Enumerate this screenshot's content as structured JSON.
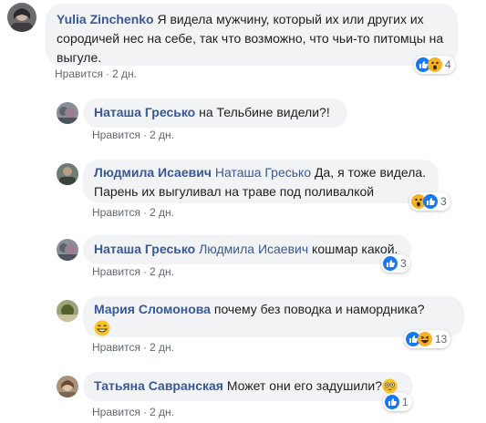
{
  "comments": [
    {
      "author": "Yulia Zinchenko",
      "reply_to": "",
      "text_line1": "Я видела мужчину, который их или других их",
      "text_line2": "сородичей нес на себе, так что возможно, что чьи-то питомцы на",
      "text_line3": "выгуле.",
      "like": "Нравится",
      "time": "2 дн.",
      "reactions_count": "4",
      "reactions": [
        "like-icon",
        "wow-icon"
      ]
    },
    {
      "author": "Наташа Гресько",
      "reply_to": "",
      "text_line1": "на Тельбине видели?!",
      "like": "Нравится",
      "time": "2 дн."
    },
    {
      "author": "Людмила Исаевич",
      "reply_to": "Наташа Гресько",
      "text_line1": "Да, я тоже видела.",
      "text_line2": "Парень их выгуливал на траве под поливалкой",
      "like": "Нравится",
      "time": "2 дн.",
      "reactions_count": "3",
      "reactions": [
        "wow-icon",
        "like-icon"
      ]
    },
    {
      "author": "Наташа Гресько",
      "reply_to": "Людмила Исаевич",
      "text_line1": "кошмар какой.",
      "like": "Нравится",
      "time": "2 дн.",
      "reactions_count": "3",
      "reactions": [
        "like-icon"
      ]
    },
    {
      "author": "Мария Сломонова",
      "reply_to": "",
      "text_line1": "почему без поводка и намордника?",
      "like": "Нравится",
      "time": "2 дн.",
      "reactions_count": "13",
      "reactions": [
        "like-icon",
        "haha-icon"
      ],
      "inline_emoji": "grin-emoji"
    },
    {
      "author": "Татьяна Савранская",
      "reply_to": "",
      "text_line1": "Может они его задушили?",
      "like": "Нравится",
      "time": "2 дн.",
      "reactions_count": "1",
      "reactions": [
        "like-icon"
      ],
      "inline_emoji": "flushed-emoji"
    }
  ],
  "separator": "·",
  "colors": {
    "link": "#385898",
    "bubble": "#f2f3f5",
    "meta": "#606770",
    "like_blue": "#1877f2",
    "react_yellow": "#f7b125"
  }
}
